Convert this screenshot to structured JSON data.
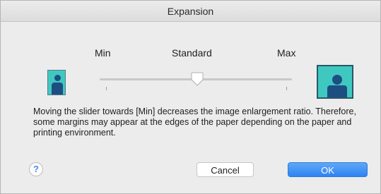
{
  "window": {
    "title": "Expansion"
  },
  "slider": {
    "min_label": "Min",
    "standard_label": "Standard",
    "max_label": "Max",
    "level": 0.5
  },
  "message": "Moving the slider towards [Min] decreases the image enlargement ratio. Therefore, some margins may appear at the edges of the paper depending on the paper and printing environment.",
  "buttons": {
    "help": "?",
    "cancel": "Cancel",
    "ok": "OK"
  },
  "colors": {
    "accent": "#2f83f2",
    "preview_fill": "#3fc8c0",
    "figure": "#1d4e82"
  },
  "icons": {
    "small_preview": "small-page-person-icon",
    "large_preview": "large-page-person-icon"
  }
}
